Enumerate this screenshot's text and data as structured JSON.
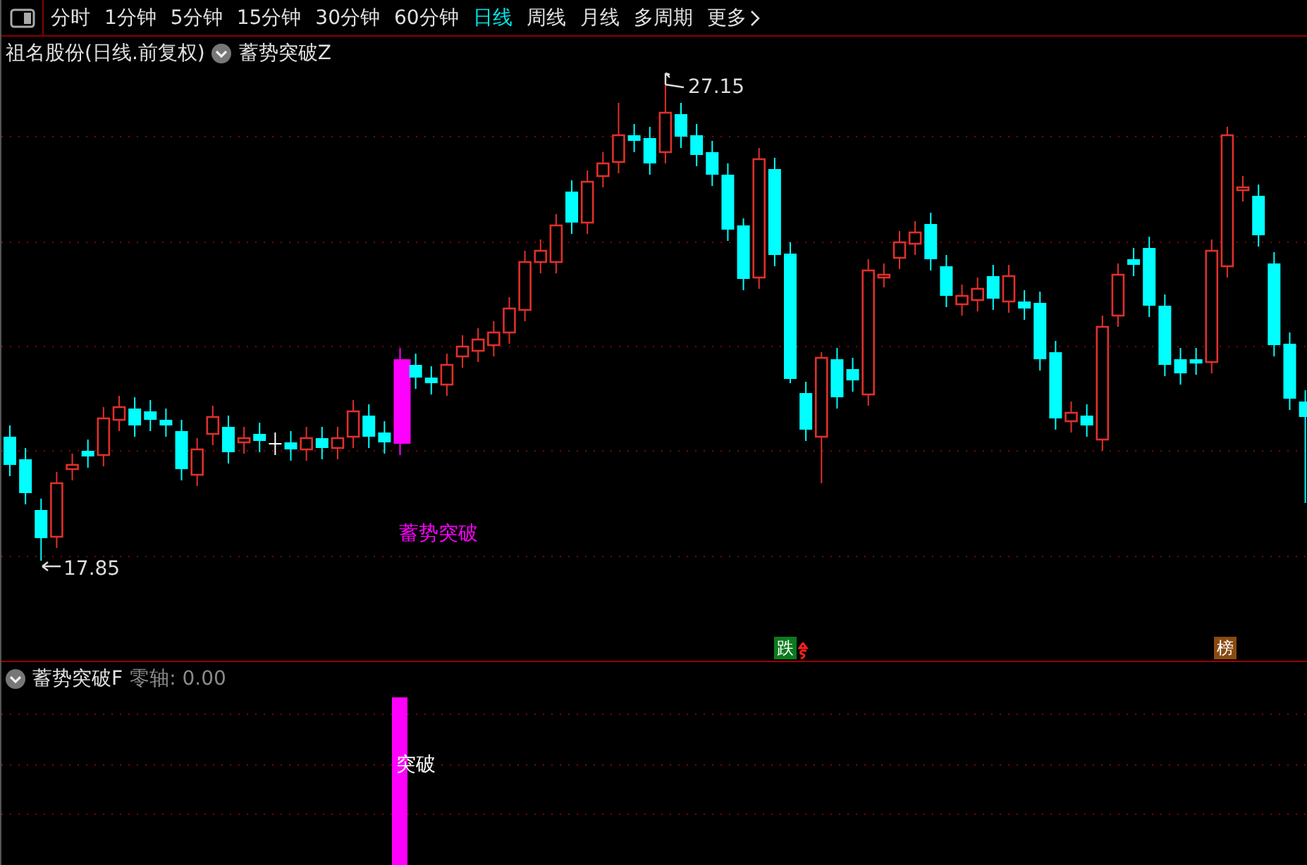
{
  "toolbar": {
    "periods": [
      {
        "label": "分时",
        "selected": false
      },
      {
        "label": "1分钟",
        "selected": false
      },
      {
        "label": "5分钟",
        "selected": false
      },
      {
        "label": "15分钟",
        "selected": false
      },
      {
        "label": "30分钟",
        "selected": false
      },
      {
        "label": "60分钟",
        "selected": false
      },
      {
        "label": "日线",
        "selected": true
      },
      {
        "label": "周线",
        "selected": false
      },
      {
        "label": "月线",
        "selected": false
      },
      {
        "label": "多周期",
        "selected": false
      }
    ],
    "more": "更多"
  },
  "main_panel": {
    "stock": "祖名股份(日线.前复权)",
    "indicator": "蓄势突破Z",
    "high_label": "27.15",
    "low_label": "17.85",
    "signal_label": "蓄势突破",
    "badges": [
      {
        "text": "跌",
        "color": "#0b7a1e"
      },
      {
        "text": "榜",
        "color": "#8a4a12"
      }
    ]
  },
  "sub_panel": {
    "indicator": "蓄势突破F",
    "zero_axis": "零轴: 0.00",
    "bar_label": "突破"
  }
}
